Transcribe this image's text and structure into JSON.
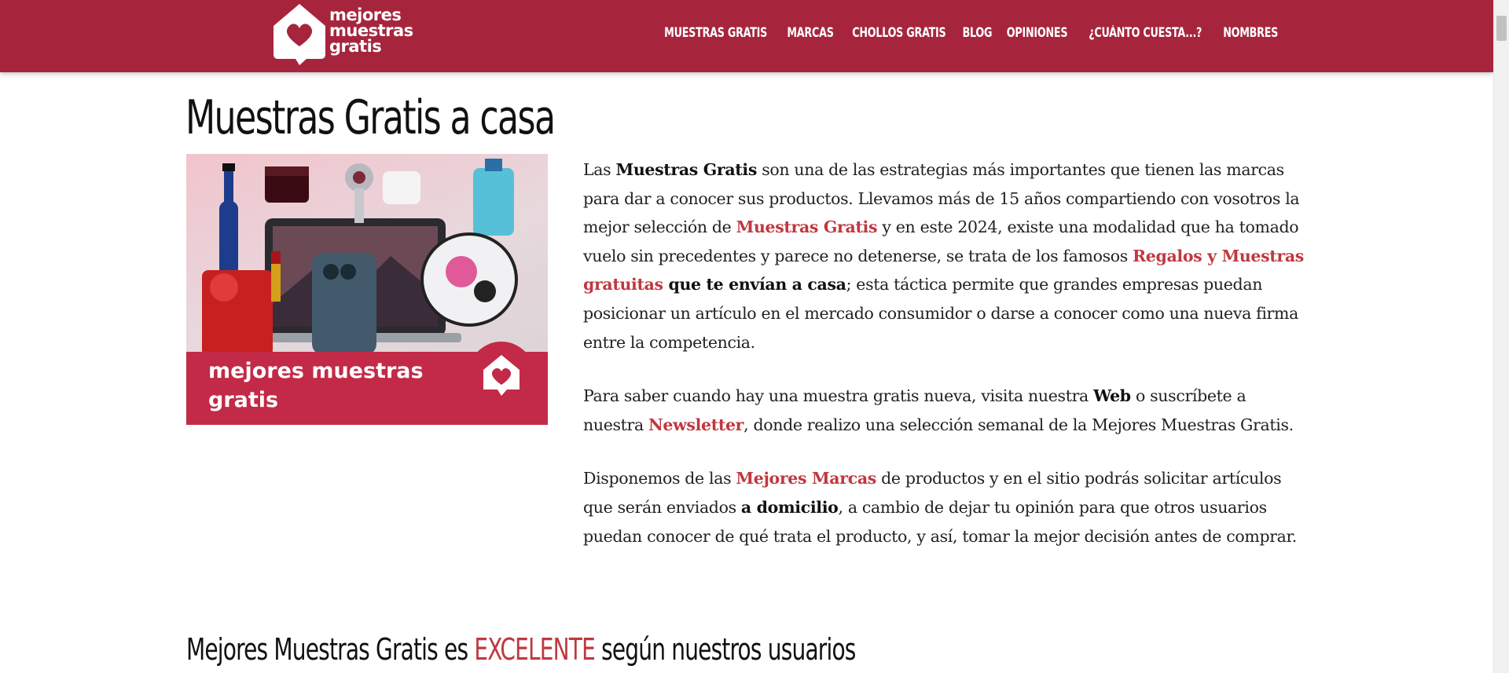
{
  "colors": {
    "brand": "#a6253d",
    "brand_secondary": "#c22a47",
    "accent": "#c0383f"
  },
  "header": {
    "logo_lines": [
      "mejores",
      "muestras",
      "gratis"
    ],
    "logo_icon": "house-heart-icon",
    "nav": [
      {
        "label": "MUESTRAS GRATIS"
      },
      {
        "label": "MARCAS"
      },
      {
        "label": "CHOLLOS GRATIS"
      },
      {
        "label": "BLOG"
      },
      {
        "label": "OPINIONES"
      },
      {
        "label": "¿CUÁNTO CUESTA...?"
      },
      {
        "label": "NOMBRES"
      }
    ]
  },
  "main": {
    "title": "Muestras Gratis a casa",
    "hero": {
      "band_lines": [
        "mejores muestras",
        "gratis"
      ],
      "badge_icon": "house-heart-icon"
    },
    "paragraphs": {
      "p1": {
        "t1": "Las ",
        "b1": "Muestras Gratis",
        "t2": " son una de las estrategias más importantes que tienen las marcas para dar a conocer sus productos. Llevamos más de 15 años compartiendo con vosotros la mejor selección de ",
        "l1": "Muestras Gratis",
        "t3": " y en este 2024, existe una modalidad que ha tomado vuelo sin precedentes y parece no detenerse, se trata de los famosos ",
        "l2": "Regalos y Muestras gratuitas",
        "b2": " que te envían a casa",
        "t4": "; esta táctica permite que grandes empresas puedan posicionar un artículo en el mercado consumidor o darse a conocer como una nueva firma entre la competencia."
      },
      "p2": {
        "t1": "Para saber cuando hay una muestra gratis nueva, visita nuestra ",
        "b1": "Web",
        "t2": " o suscríbete a nuestra ",
        "l1": "Newsletter",
        "t3": ", donde realizo una selección semanal de la Mejores Muestras Gratis."
      },
      "p3": {
        "t1": "Disponemos de las ",
        "l1": "Mejores Marcas",
        "t2": " de productos y en el sitio podrás solicitar artículos que serán enviados ",
        "b1": "a domicilio",
        "t3": ", a cambio de dejar tu opinión para que otros usuarios puedan conocer de qué trata el producto, y así, tomar la mejor decisión antes de comprar."
      }
    },
    "rating_heading": {
      "before": "Mejores Muestras Gratis es ",
      "highlight": "EXCELENTE",
      "after": " según nuestros usuarios"
    }
  }
}
